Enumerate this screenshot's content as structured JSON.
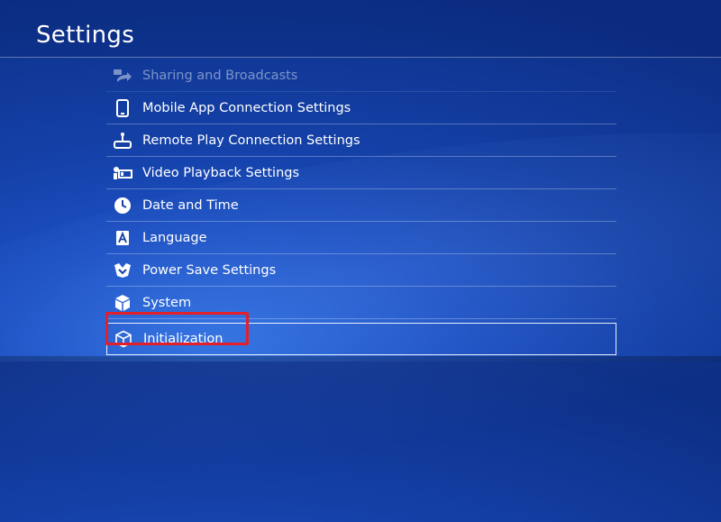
{
  "header": {
    "title": "Settings"
  },
  "menu": {
    "items": [
      {
        "label": "Sharing and Broadcasts",
        "icon": "share-icon"
      },
      {
        "label": "Mobile App Connection Settings",
        "icon": "phone-icon"
      },
      {
        "label": "Remote Play Connection Settings",
        "icon": "remote-play-icon"
      },
      {
        "label": "Video Playback Settings",
        "icon": "video-playback-icon"
      },
      {
        "label": "Date and Time",
        "icon": "clock-icon"
      },
      {
        "label": "Language",
        "icon": "language-icon"
      },
      {
        "label": "Power Save Settings",
        "icon": "power-save-icon"
      },
      {
        "label": "System",
        "icon": "system-cube-icon"
      },
      {
        "label": "Initialization",
        "icon": "initialization-cube-icon"
      }
    ],
    "selected_index": 8
  },
  "colors": {
    "background": "#1440a6",
    "annotation_box": "#e3202a",
    "text": "#ffffff"
  }
}
